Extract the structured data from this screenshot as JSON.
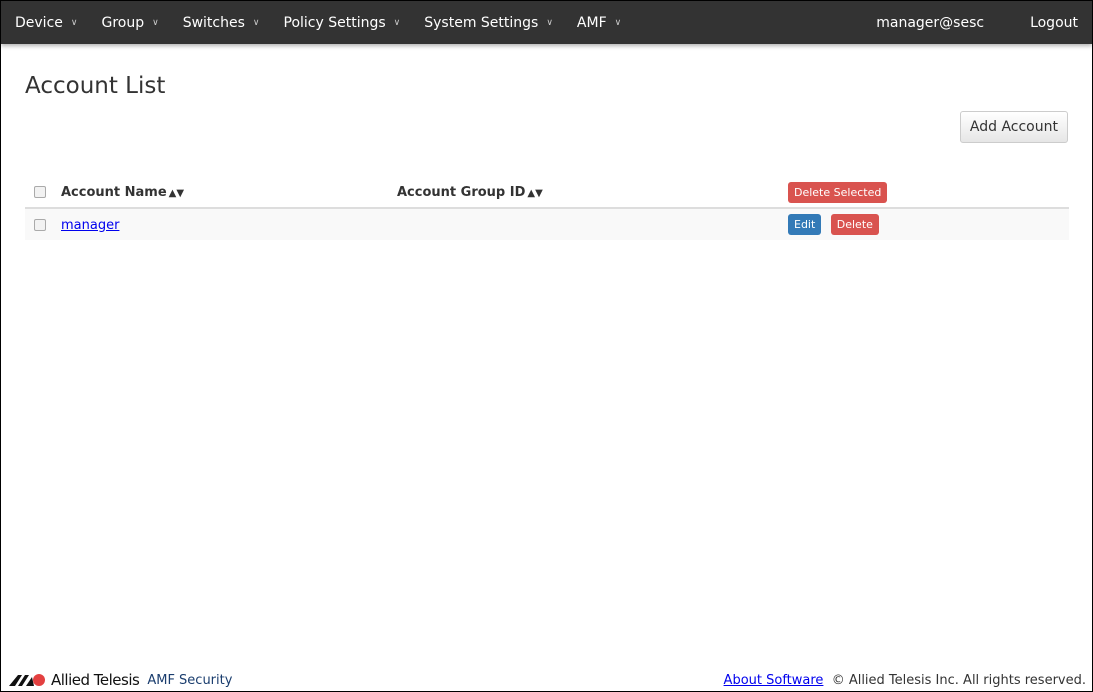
{
  "nav": {
    "items": [
      "Device",
      "Group",
      "Switches",
      "Policy Settings",
      "System Settings",
      "AMF"
    ],
    "user": "manager@sesc",
    "logout": "Logout"
  },
  "page": {
    "title": "Account List",
    "add_button": "Add Account"
  },
  "table": {
    "columns": [
      "Account Name",
      "Account Group ID"
    ],
    "delete_selected": "Delete Selected",
    "rows": [
      {
        "name": "manager",
        "group_id": "",
        "edit": "Edit",
        "delete": "Delete"
      }
    ]
  },
  "footer": {
    "brand": "Allied Telesis",
    "product": "AMF Security",
    "about": "About Software",
    "copyright": "© Allied Telesis Inc. All rights reserved."
  }
}
